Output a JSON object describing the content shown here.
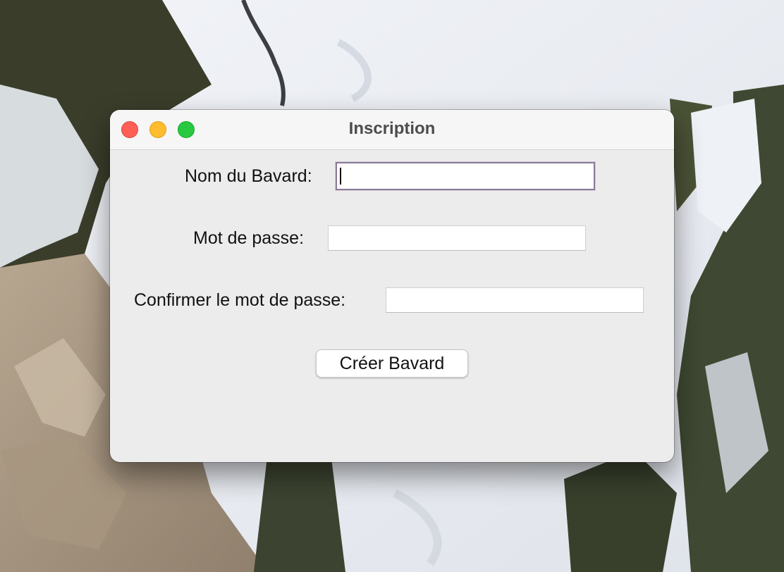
{
  "window": {
    "title": "Inscription"
  },
  "form": {
    "username_label": "Nom du Bavard:",
    "username_value": "",
    "password_label": "Mot de passe:",
    "password_value": "",
    "confirm_label": "Confirmer le mot de passe:",
    "confirm_value": ""
  },
  "actions": {
    "create_label": "Créer Bavard"
  },
  "icons": {
    "close": "close-icon",
    "minimize": "minimize-icon",
    "zoom": "zoom-icon"
  },
  "colors": {
    "close": "#fe5f57",
    "minimize": "#febc2e",
    "zoom": "#28c840",
    "window_bg": "#ececec",
    "focus_border": "#8a7a96"
  }
}
